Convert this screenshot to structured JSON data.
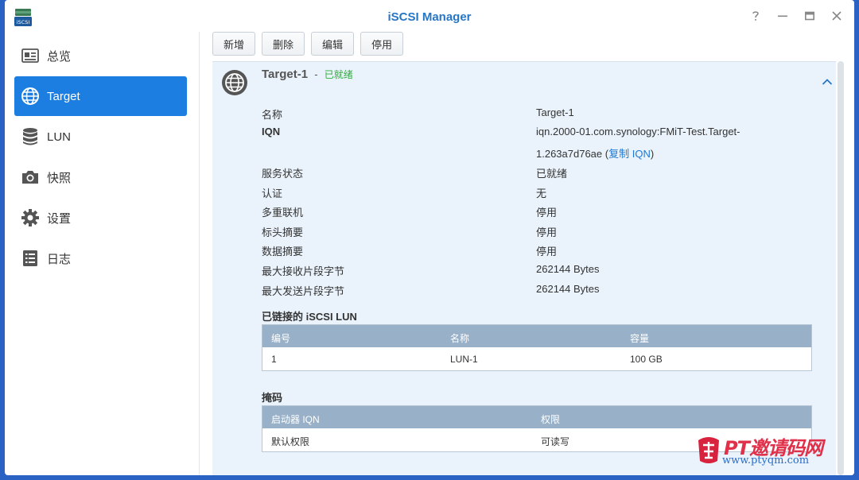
{
  "window": {
    "title": "iSCSI Manager",
    "app_icon_label": "iSCSI"
  },
  "sidebar": {
    "items": [
      {
        "label": "总览",
        "icon": "overview-icon"
      },
      {
        "label": "Target",
        "icon": "globe-icon",
        "active": true
      },
      {
        "label": "LUN",
        "icon": "database-icon"
      },
      {
        "label": "快照",
        "icon": "camera-icon"
      },
      {
        "label": "设置",
        "icon": "gear-icon"
      },
      {
        "label": "日志",
        "icon": "log-icon"
      }
    ]
  },
  "toolbar": {
    "add": "新增",
    "delete": "删除",
    "edit": "编辑",
    "disable": "停用"
  },
  "target": {
    "name": "Target-1",
    "separator": "-",
    "status": "已就绪",
    "details": [
      {
        "key": "名称",
        "value": "Target-1"
      },
      {
        "key": "IQN",
        "value": "iqn.2000-01.com.synology:FMiT-Test.Target-",
        "value2": "1.263a7d76ae",
        "copy_open": "(",
        "copy_link": "复制 IQN",
        "copy_close": ")"
      },
      {
        "key": "服务状态",
        "value": "已就绪"
      },
      {
        "key": "认证",
        "value": "无"
      },
      {
        "key": "多重联机",
        "value": "停用"
      },
      {
        "key": "标头摘要",
        "value": "停用"
      },
      {
        "key": "数据摘要",
        "value": "停用"
      },
      {
        "key": "最大接收片段字节",
        "value": "262144 Bytes"
      },
      {
        "key": "最大发送片段字节",
        "value": "262144 Bytes"
      }
    ]
  },
  "lun_section": {
    "title": "已链接的 iSCSI LUN",
    "columns": [
      "编号",
      "名称",
      "容量"
    ],
    "rows": [
      [
        "1",
        "LUN-1",
        "100 GB"
      ]
    ]
  },
  "mask_section": {
    "title": "掩码",
    "columns": [
      "启动器 IQN",
      "权限"
    ],
    "rows": [
      [
        "默认权限",
        "可读写"
      ]
    ]
  },
  "watermark": {
    "text": "PT邀请码网",
    "url": "www.ptyqm.com"
  },
  "colors": {
    "accent": "#1b7ee0",
    "title": "#2776c5",
    "ok": "#2eac3c",
    "panel": "#eaf3fb",
    "grid_header": "#98b1c8"
  }
}
